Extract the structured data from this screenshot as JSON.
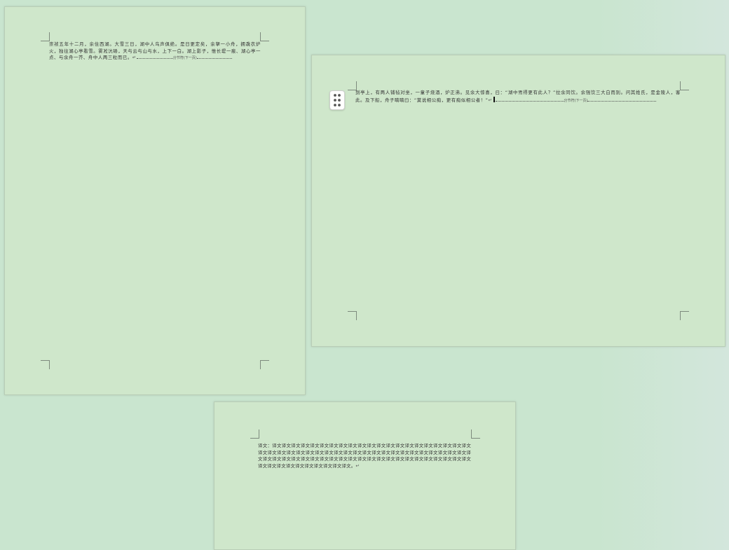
{
  "pages": [
    {
      "paragraph": "崇祯五年十二月，余住西湖。大雪三日，湖中人鸟声俱绝。是日更定矣，余拏一小舟，拥毳衣炉火，独往湖心亭看雪。雾凇沆砀，天与云与山与水，上下一白。湖上影子，惟长堤一痕、湖心亭一点、与余舟一芥、舟中人两三粒而已。",
      "break_label": "分节符(下一页)"
    },
    {
      "paragraph": "到亭上，有两人铺毡对坐，一童子烧酒，炉正沸。见余大惊喜，曰：“湖中焉得更有此人？”拉余同饮。余强饮三大白而别。问其姓氏，是金陵人，客此。及下船，舟子喃喃曰：“莫说相公痴，更有痴似相公者！”",
      "break_label": "分节符(下一页)"
    },
    {
      "paragraph": "译文：译文译文译文译文译文译文译文译文译文译文译文译文译文译文译文译文译文译文译文译文译文译文译文译文译文译文译文译文译文译文译文译文译文译文译文译文译文译文译文译文译文译文译文译文译文译文译文译文译文译文译文译文译文译文译文译文译文译文译文译文译文译文译文译文译文译文译文译文译文译文译文译文译文译文译文译文。"
    }
  ],
  "icons": {
    "drag_handle": "drag-handle-six-dots-icon"
  },
  "colors": {
    "workspace": "#c9e5cf",
    "page": "#cfe7cb"
  }
}
